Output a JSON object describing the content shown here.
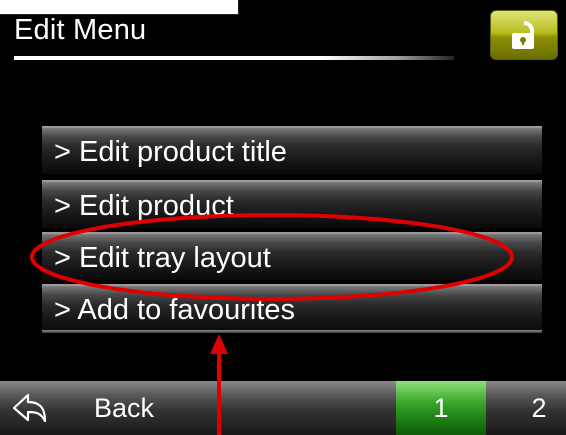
{
  "header": {
    "title": "Edit Menu",
    "lock_icon": "unlocked-padlock-icon",
    "lock_color": "#b9bd1e"
  },
  "menu": {
    "items": [
      {
        "label": "> Edit product title"
      },
      {
        "label": "> Edit product"
      },
      {
        "label": "> Edit tray layout"
      },
      {
        "label": "> Add to favourites"
      }
    ]
  },
  "footer": {
    "back_icon": "back-arrow-icon",
    "back_label": "Back",
    "pages": [
      {
        "label": "1",
        "active": true,
        "color": "#3aa52b"
      },
      {
        "label": "2",
        "active": false
      }
    ]
  },
  "annotation": {
    "highlighted_item": "> Edit tray layout",
    "color": "#e00000"
  }
}
